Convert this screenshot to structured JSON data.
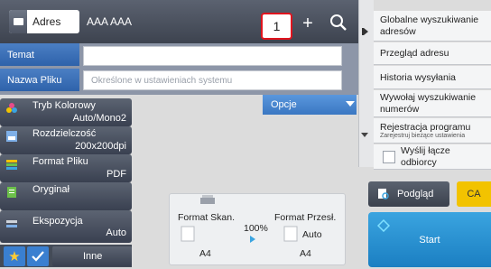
{
  "header": {
    "address_label": "Adres",
    "address_value": "AAA AAA",
    "destination_count": "1",
    "plus": "+"
  },
  "fields": {
    "subject_label": "Temat",
    "subject_value": "",
    "filename_label": "Nazwa Pliku",
    "filename_placeholder": "Określone w ustawieniach systemu"
  },
  "settings": [
    {
      "label": "Tryb Kolorowy",
      "value": "Auto/Mono2",
      "icon": "color-mode-icon"
    },
    {
      "label": "Rozdzielczość",
      "value": "200x200dpi",
      "icon": "resolution-icon"
    },
    {
      "label": "Format Pliku",
      "value": "PDF",
      "icon": "file-format-icon"
    },
    {
      "label": "Oryginał",
      "value": "",
      "icon": "original-icon"
    },
    {
      "label": "Ekspozycja",
      "value": "Auto",
      "icon": "exposure-icon"
    }
  ],
  "options_label": "Opcje",
  "preview": {
    "scan_label": "Format Skan.",
    "send_label": "Format Przesł.",
    "ratio": "100%",
    "scan_size": "A4",
    "send_auto": "Auto",
    "send_size": "A4"
  },
  "right_menu": [
    "Globalne wyszukiwanie adresów",
    "Przegląd adresu",
    "Historia wysyłania",
    "Wywołaj wyszukiwanie numerów"
  ],
  "program": {
    "title": "Rejestracja programu",
    "subtitle": "Zarejestruj bieżące ustawienia"
  },
  "reply_label": "Wyślij łącze odbiorcy",
  "actions": {
    "preview": "Podgląd",
    "ca": "CA",
    "start": "Start",
    "other": "Inne"
  },
  "colors": {
    "accent_blue": "#2e62aa",
    "highlight_red": "#e0141e",
    "start_blue": "#1b7fc2",
    "ca_yellow": "#f2c300"
  }
}
